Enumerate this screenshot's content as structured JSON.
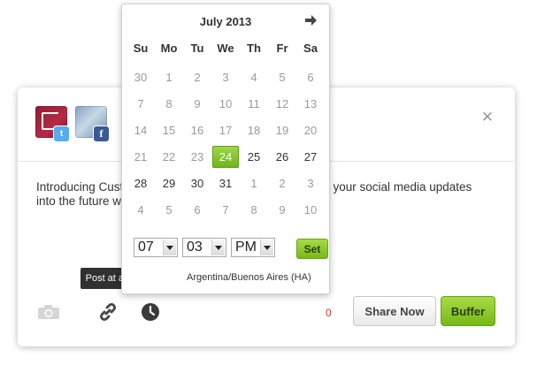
{
  "composer": {
    "message": "Introducing Custom Scheduling, a new way to schedule your social media updates into the future with Buffer: http://buff.ly/13aM2cE",
    "char_count": "0",
    "share_now_label": "Share Now",
    "buffer_label": "Buffer",
    "close_label": "✕",
    "profiles": [
      {
        "network": "twitter",
        "badge": "t",
        "badge_color": "#55acee"
      },
      {
        "network": "facebook",
        "badge": "f",
        "badge_color": "#3b5998"
      }
    ]
  },
  "tooltip": {
    "text": "Post at a custom time"
  },
  "datepicker": {
    "month_label": "July 2013",
    "weekdays": [
      "Su",
      "Mo",
      "Tu",
      "We",
      "Th",
      "Fr",
      "Sa"
    ],
    "weeks": [
      [
        "30",
        "1",
        "2",
        "3",
        "4",
        "5",
        "6"
      ],
      [
        "7",
        "8",
        "9",
        "10",
        "11",
        "12",
        "13"
      ],
      [
        "14",
        "15",
        "16",
        "17",
        "18",
        "19",
        "20"
      ],
      [
        "21",
        "22",
        "23",
        "24",
        "25",
        "26",
        "27"
      ],
      [
        "28",
        "29",
        "30",
        "31",
        "1",
        "2",
        "3"
      ],
      [
        "4",
        "5",
        "6",
        "7",
        "8",
        "9",
        "10"
      ]
    ],
    "selected_day": "24",
    "hour": "07",
    "minute": "03",
    "ampm": "PM",
    "set_label": "Set",
    "timezone": "Argentina/Buenos Aires (HA)"
  },
  "colors": {
    "accent_green": "#8cc832",
    "count_red": "#c0392b"
  }
}
